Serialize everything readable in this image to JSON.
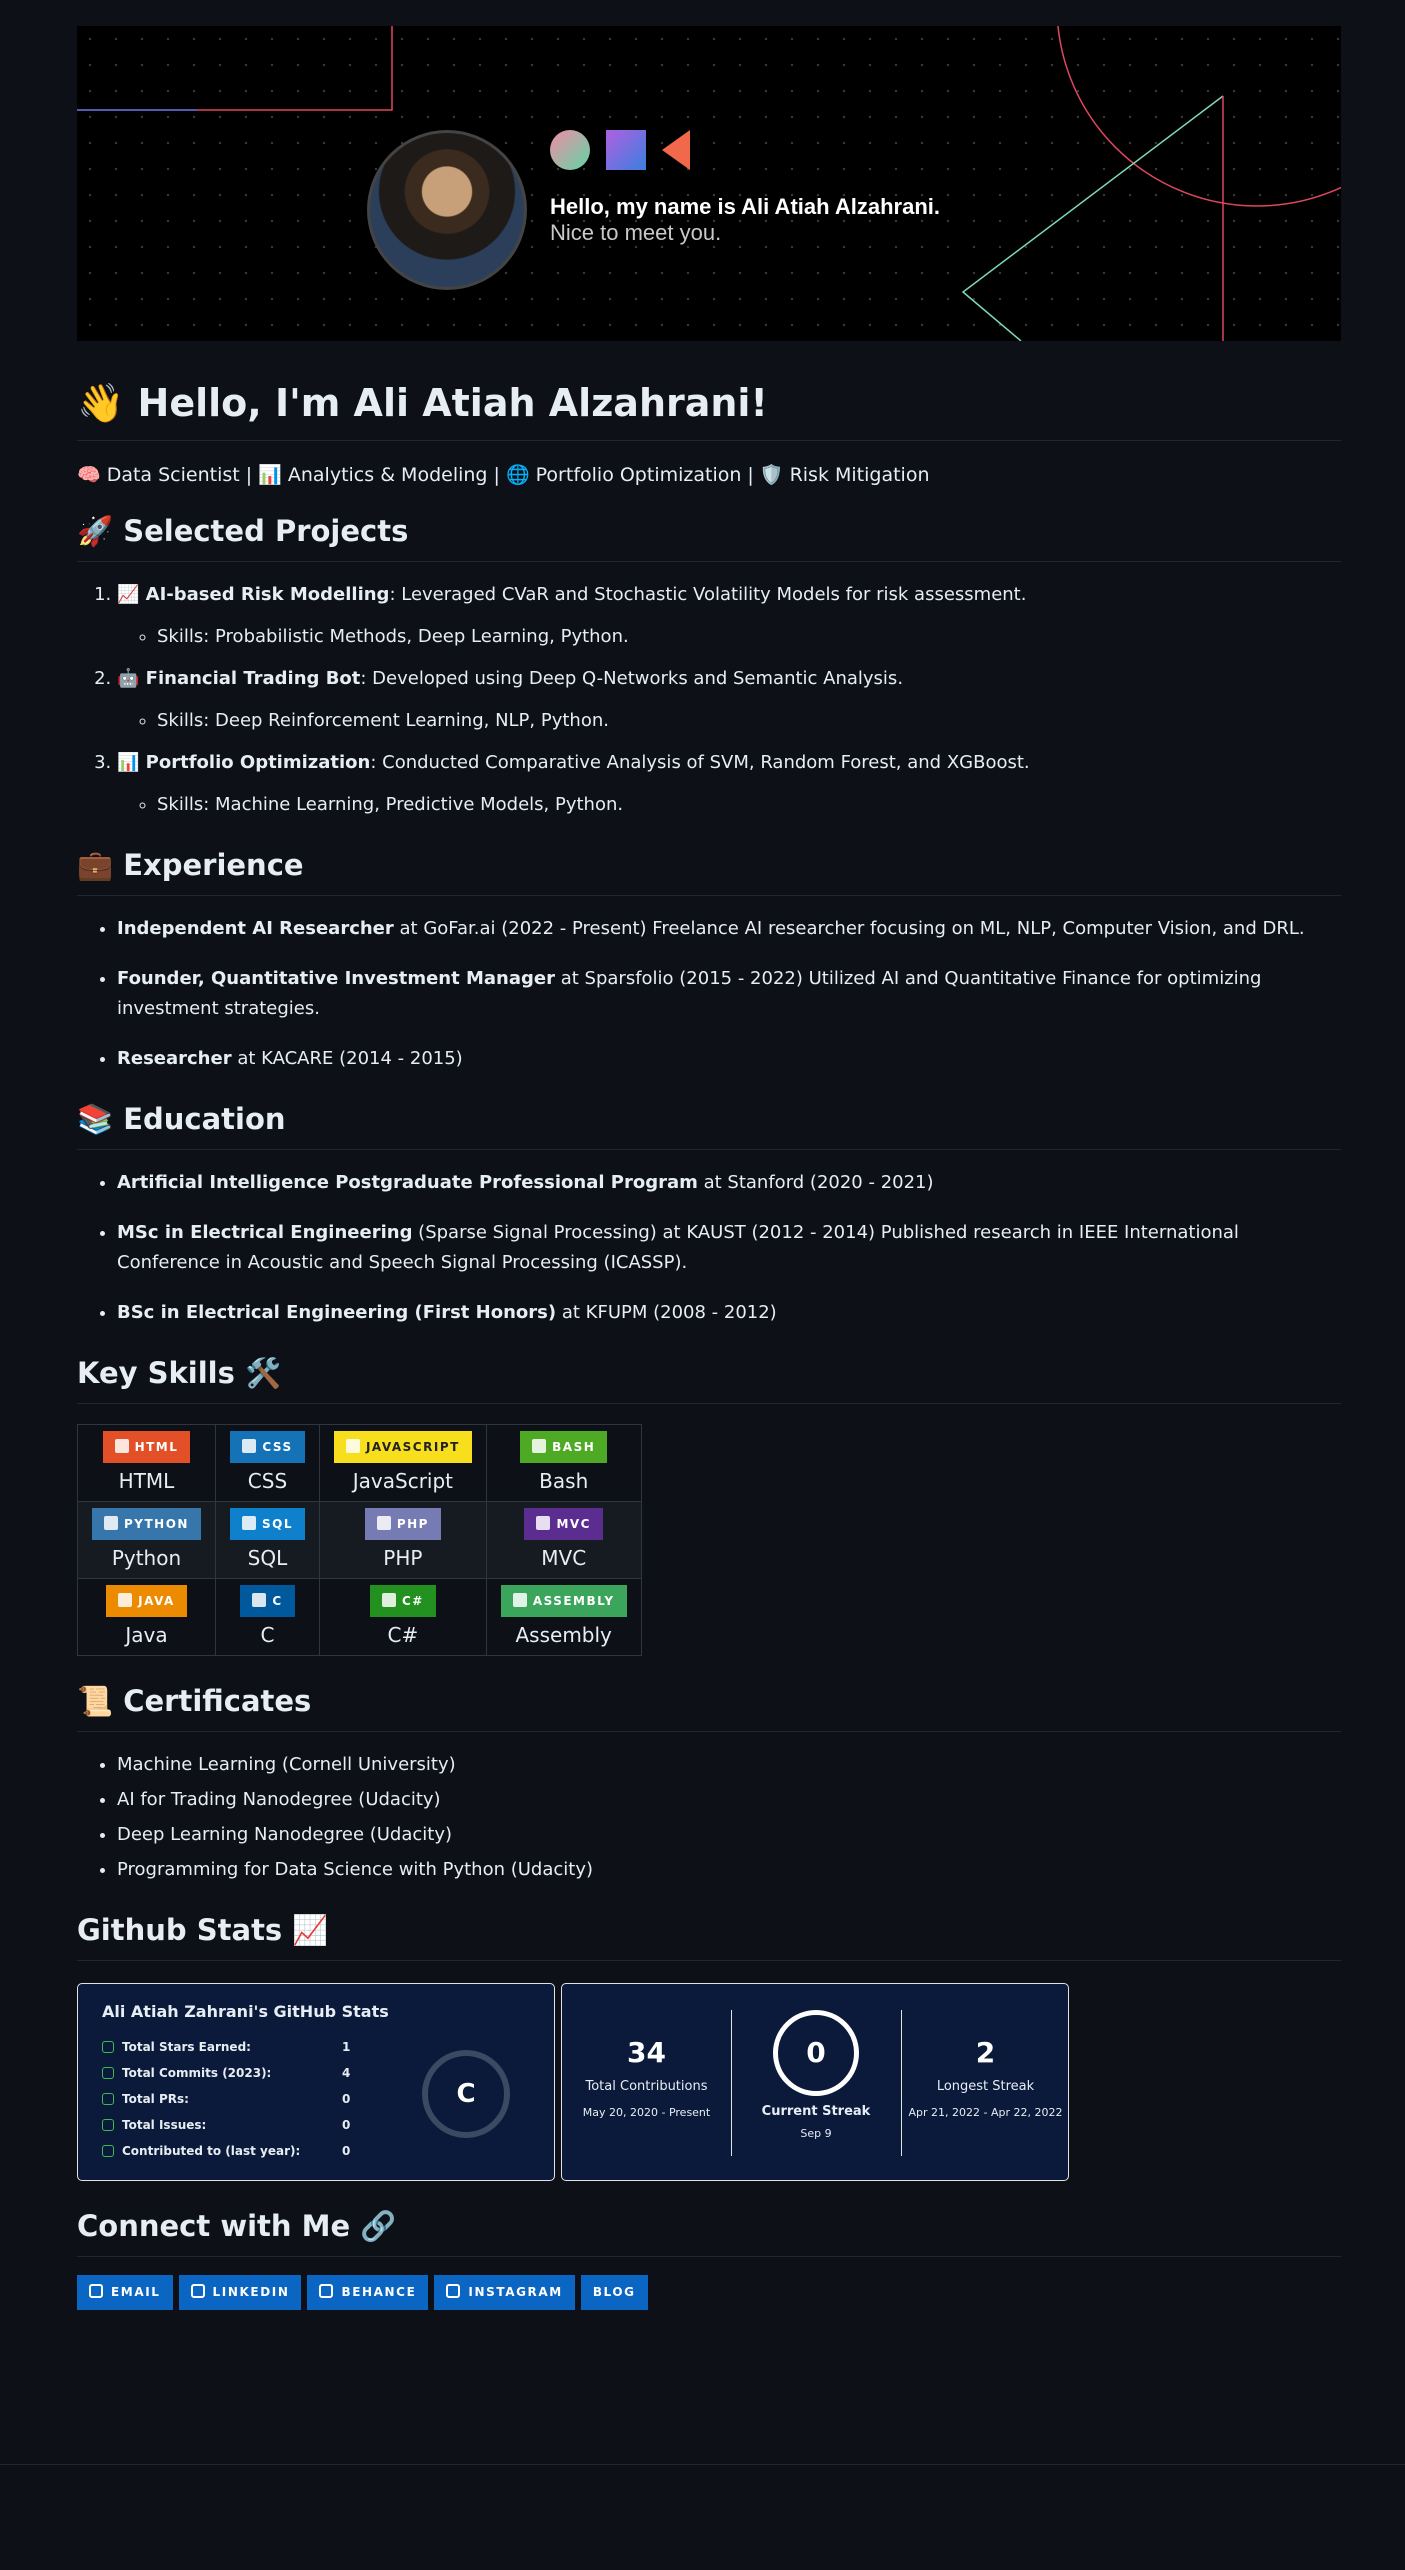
{
  "banner": {
    "greeting": "Hello, my name is Ali Atiah Alzahrani.",
    "subtitle": "Nice to meet you."
  },
  "intro": {
    "title": "👋 Hello, I'm Ali Atiah Alzahrani!",
    "tagline": "🧠 Data Scientist | 📊 Analytics & Modeling | 🌐 Portfolio Optimization | 🛡️ Risk Mitigation"
  },
  "projects": {
    "heading": "🚀 Selected Projects",
    "items": [
      {
        "title": "📈 AI-based Risk Modelling",
        "desc": ": Leveraged CVaR and Stochastic Volatility Models for risk assessment.",
        "skills": "Skills: Probabilistic Methods, Deep Learning, Python."
      },
      {
        "title": "🤖 Financial Trading Bot",
        "desc": ": Developed using Deep Q-Networks and Semantic Analysis.",
        "skills": "Skills: Deep Reinforcement Learning, NLP, Python."
      },
      {
        "title": "📊 Portfolio Optimization",
        "desc": ": Conducted Comparative Analysis of SVM, Random Forest, and XGBoost.",
        "skills": "Skills: Machine Learning, Predictive Models, Python."
      }
    ]
  },
  "experience": {
    "heading": "💼 Experience",
    "items": [
      {
        "role": "Independent AI Researcher",
        "rest": " at GoFar.ai (2022 - Present) Freelance AI researcher focusing on ML, NLP, Computer Vision, and DRL."
      },
      {
        "role": "Founder, Quantitative Investment Manager",
        "rest": " at Sparsfolio (2015 - 2022) Utilized AI and Quantitative Finance for optimizing investment strategies."
      },
      {
        "role": "Researcher",
        "rest": " at KACARE (2014 - 2015)"
      }
    ]
  },
  "education": {
    "heading": "📚 Education",
    "items": [
      {
        "degree": "Artificial Intelligence Postgraduate Professional Program",
        "rest": " at Stanford (2020 - 2021)"
      },
      {
        "degree": "MSc in Electrical Engineering",
        "rest": " (Sparse Signal Processing) at KAUST (2012 - 2014) Published research in IEEE International Conference in Acoustic and Speech Signal Processing (ICASSP)."
      },
      {
        "degree": "BSc in Electrical Engineering (First Honors)",
        "rest": " at KFUPM (2008 - 2012)"
      }
    ]
  },
  "skills": {
    "heading": "Key Skills 🛠️",
    "rows": [
      [
        {
          "badge": "HTML",
          "label": "HTML",
          "color": "#e34f26"
        },
        {
          "badge": "CSS",
          "label": "CSS",
          "color": "#1572b6"
        },
        {
          "badge": "JAVASCRIPT",
          "label": "JavaScript",
          "color": "#f7df1e"
        },
        {
          "badge": "BASH",
          "label": "Bash",
          "color": "#4eaa25"
        }
      ],
      [
        {
          "badge": "PYTHON",
          "label": "Python",
          "color": "#3776ab"
        },
        {
          "badge": "SQL",
          "label": "SQL",
          "color": "#0f80cc"
        },
        {
          "badge": "PHP",
          "label": "PHP",
          "color": "#777bb4"
        },
        {
          "badge": "MVC",
          "label": "MVC",
          "color": "#5c2d91"
        }
      ],
      [
        {
          "badge": "JAVA",
          "label": "Java",
          "color": "#ed8b00"
        },
        {
          "badge": "C",
          "label": "C",
          "color": "#00599c"
        },
        {
          "badge": "C#",
          "label": "C#",
          "color": "#239120"
        },
        {
          "badge": "ASSEMBLY",
          "label": "Assembly",
          "color": "#3ba55c"
        }
      ]
    ]
  },
  "certificates": {
    "heading": "📜 Certificates",
    "items": [
      "Machine Learning (Cornell University)",
      "AI for Trading Nanodegree (Udacity)",
      "Deep Learning Nanodegree (Udacity)",
      "Programming for Data Science with Python (Udacity)"
    ]
  },
  "github": {
    "heading": "Github Stats 📈",
    "stats_card": {
      "title": "Ali Atiah Zahrani's GitHub Stats",
      "rows": [
        {
          "label": "Total Stars Earned:",
          "value": "1"
        },
        {
          "label": "Total Commits (2023):",
          "value": "4"
        },
        {
          "label": "Total PRs:",
          "value": "0"
        },
        {
          "label": "Total Issues:",
          "value": "0"
        },
        {
          "label": "Contributed to (last year):",
          "value": "0"
        }
      ],
      "rank": "C"
    },
    "streak_card": {
      "total": "34",
      "total_label": "Total Contributions",
      "total_range": "May 20, 2020 - Present",
      "current": "0",
      "current_label": "Current Streak",
      "current_range": "Sep 9",
      "longest": "2",
      "longest_label": "Longest Streak",
      "longest_range": "Apr 21, 2022 - Apr 22, 2022"
    }
  },
  "connect": {
    "heading": "Connect with Me 🔗",
    "buttons": [
      "EMAIL",
      "LINKEDIN",
      "BEHANCE",
      "INSTAGRAM",
      "BLOG"
    ]
  }
}
